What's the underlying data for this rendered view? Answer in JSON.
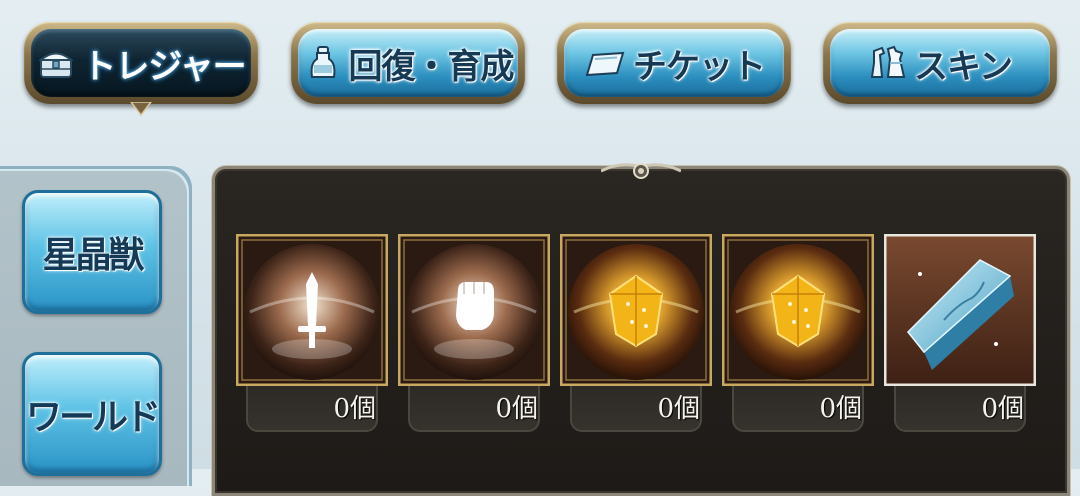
{
  "tabs": [
    {
      "label": "トレジャー",
      "icon": "treasure-chest-icon",
      "active": true
    },
    {
      "label": "回復・育成",
      "icon": "potion-bottle-icon",
      "active": false
    },
    {
      "label": "チケット",
      "icon": "ticket-icon",
      "active": false
    },
    {
      "label": "スキン",
      "icon": "outfit-icon",
      "active": false
    }
  ],
  "sidebar": {
    "items": [
      {
        "label": "星晶獣"
      },
      {
        "label": "ワールド"
      }
    ]
  },
  "items": [
    {
      "icon": "sword-orb-icon",
      "count": "0個"
    },
    {
      "icon": "fist-orb-icon",
      "count": "0個"
    },
    {
      "icon": "gold-crystal-orb-icon",
      "count": "0個"
    },
    {
      "icon": "gold-crystal-orb-icon",
      "count": "0個"
    },
    {
      "icon": "silver-ingot-icon",
      "count": "0個"
    }
  ]
}
